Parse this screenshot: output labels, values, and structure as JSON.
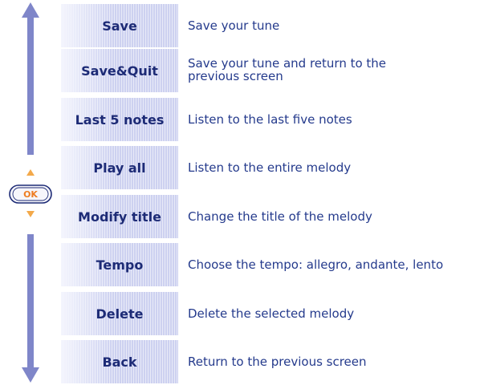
{
  "navigation": {
    "ok_label": "OK",
    "colors": {
      "arrow": "#7f86c9",
      "ok_border": "#1d2b76",
      "ok_text": "#ee7d22",
      "ok_fill": "#f6f6fb",
      "nav_triangles": "#f3a94a"
    },
    "icons": [
      "up-arrow-icon",
      "ok-button-icon",
      "nav-up-triangle-icon",
      "nav-down-triangle-icon",
      "down-arrow-icon"
    ]
  },
  "menu": {
    "items": [
      {
        "label": "Save",
        "description": "Save your tune"
      },
      {
        "label": "Save&Quit",
        "description": "Save your tune and return to the previous screen"
      },
      {
        "label": "Last 5 notes",
        "description": "Listen to the last five notes"
      },
      {
        "label": "Play all",
        "description": "Listen to the entire melody"
      },
      {
        "label": "Modify title",
        "description": "Change the title of the melody"
      },
      {
        "label": "Tempo",
        "description": "Choose the tempo: allegro, andante, lento"
      },
      {
        "label": "Delete",
        "description": "Delete the selected melody"
      },
      {
        "label": "Back",
        "description": "Return to the previous screen"
      }
    ]
  }
}
